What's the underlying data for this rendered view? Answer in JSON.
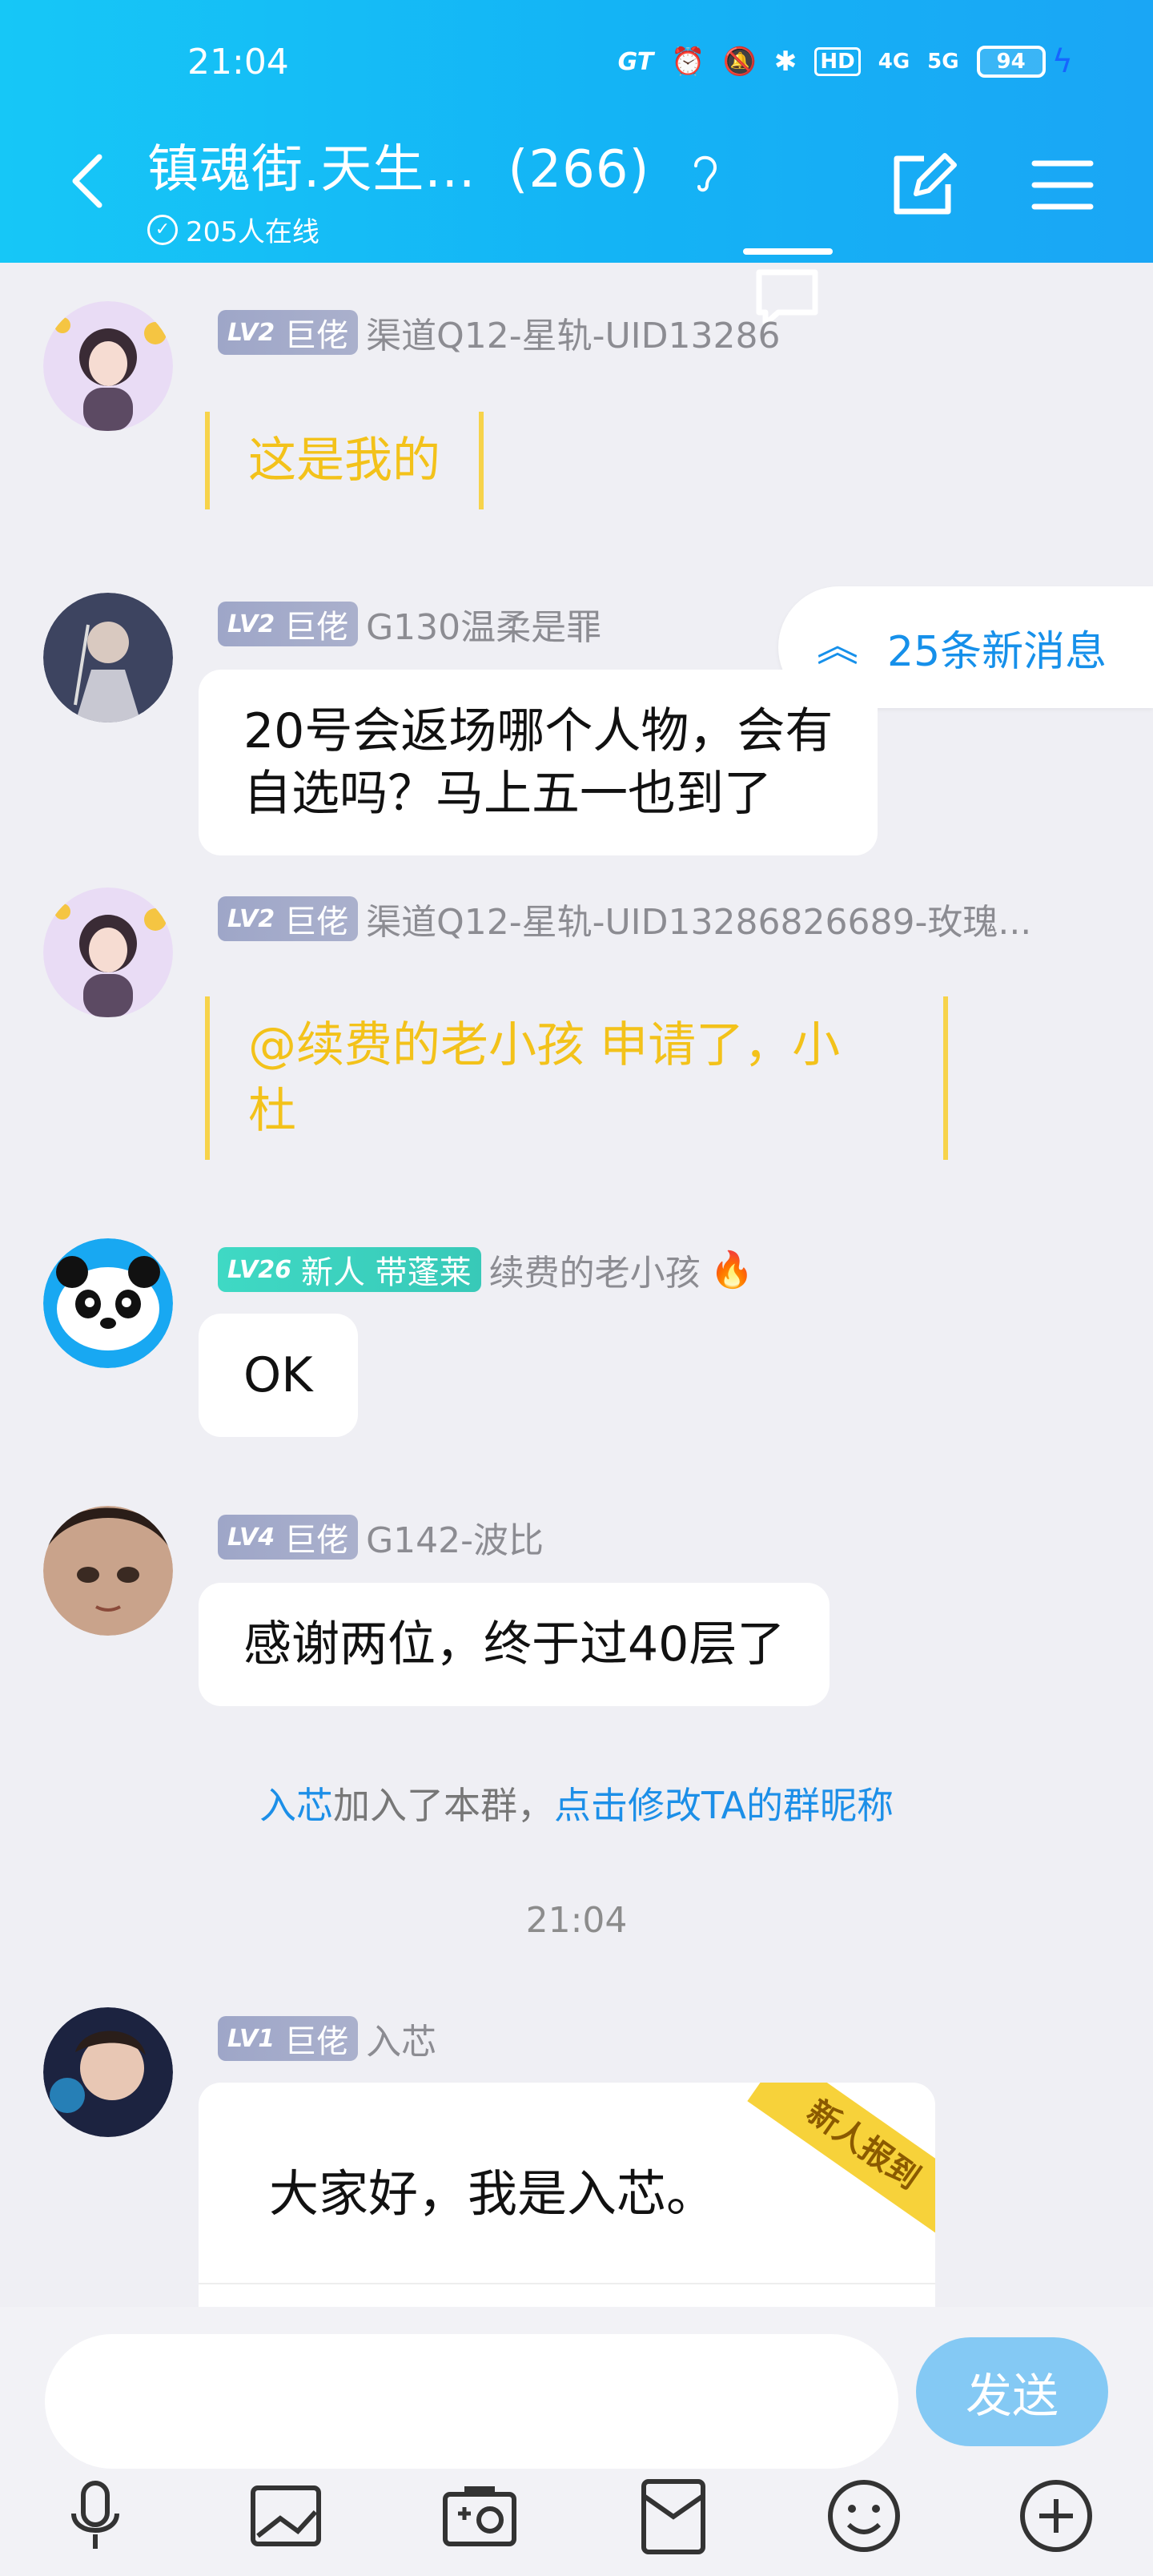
{
  "status_bar": {
    "time": "21:04",
    "network": "GT",
    "hd": "HD",
    "net4g": "4G",
    "net5g": "5G",
    "battery": "94"
  },
  "header": {
    "title": "镇魂街.天生...",
    "member_count": "(266)",
    "online": "205人在线"
  },
  "new_messages": "25条新消息",
  "messages": [
    {
      "level": "LV2",
      "title": "巨佬",
      "nick": "渠道Q12-星轨-UID13286",
      "text": "这是我的",
      "style": "gold"
    },
    {
      "level": "LV2",
      "title": "巨佬",
      "nick": "G130温柔是罪",
      "text_line1": "20号会返场哪个人物，会有",
      "text_line2": "自选吗？马上五一也到了"
    },
    {
      "level": "LV2",
      "title": "巨佬",
      "nick": "渠道Q12-星轨-UID13286826689-玫瑰...",
      "text_line1": "@续费的老小孩 申请了，小",
      "text_line2": "杜",
      "style": "gold"
    },
    {
      "level": "LV26",
      "title": "新人 带蓬莱",
      "nick": "续费的老小孩",
      "text": "OK"
    },
    {
      "level": "LV4",
      "title": "巨佬",
      "nick": "G142-波比",
      "text": "感谢两位，终于过40层了"
    }
  ],
  "system": {
    "name": "入芯",
    "joined": "加入了本群，",
    "link": "点击修改TA的群昵称"
  },
  "time_divider": "21:04",
  "last_message": {
    "level": "LV1",
    "title": "巨佬",
    "nick": "入芯",
    "card_text": "大家好，我是入芯。",
    "ribbon": "新人报到"
  },
  "input": {
    "placeholder": "",
    "value": ""
  },
  "send_label": "发送",
  "colors": {
    "header": "#16c7f7",
    "accent": "#1690ea",
    "gold": "#f3c21a",
    "send": "#84c9f4"
  }
}
